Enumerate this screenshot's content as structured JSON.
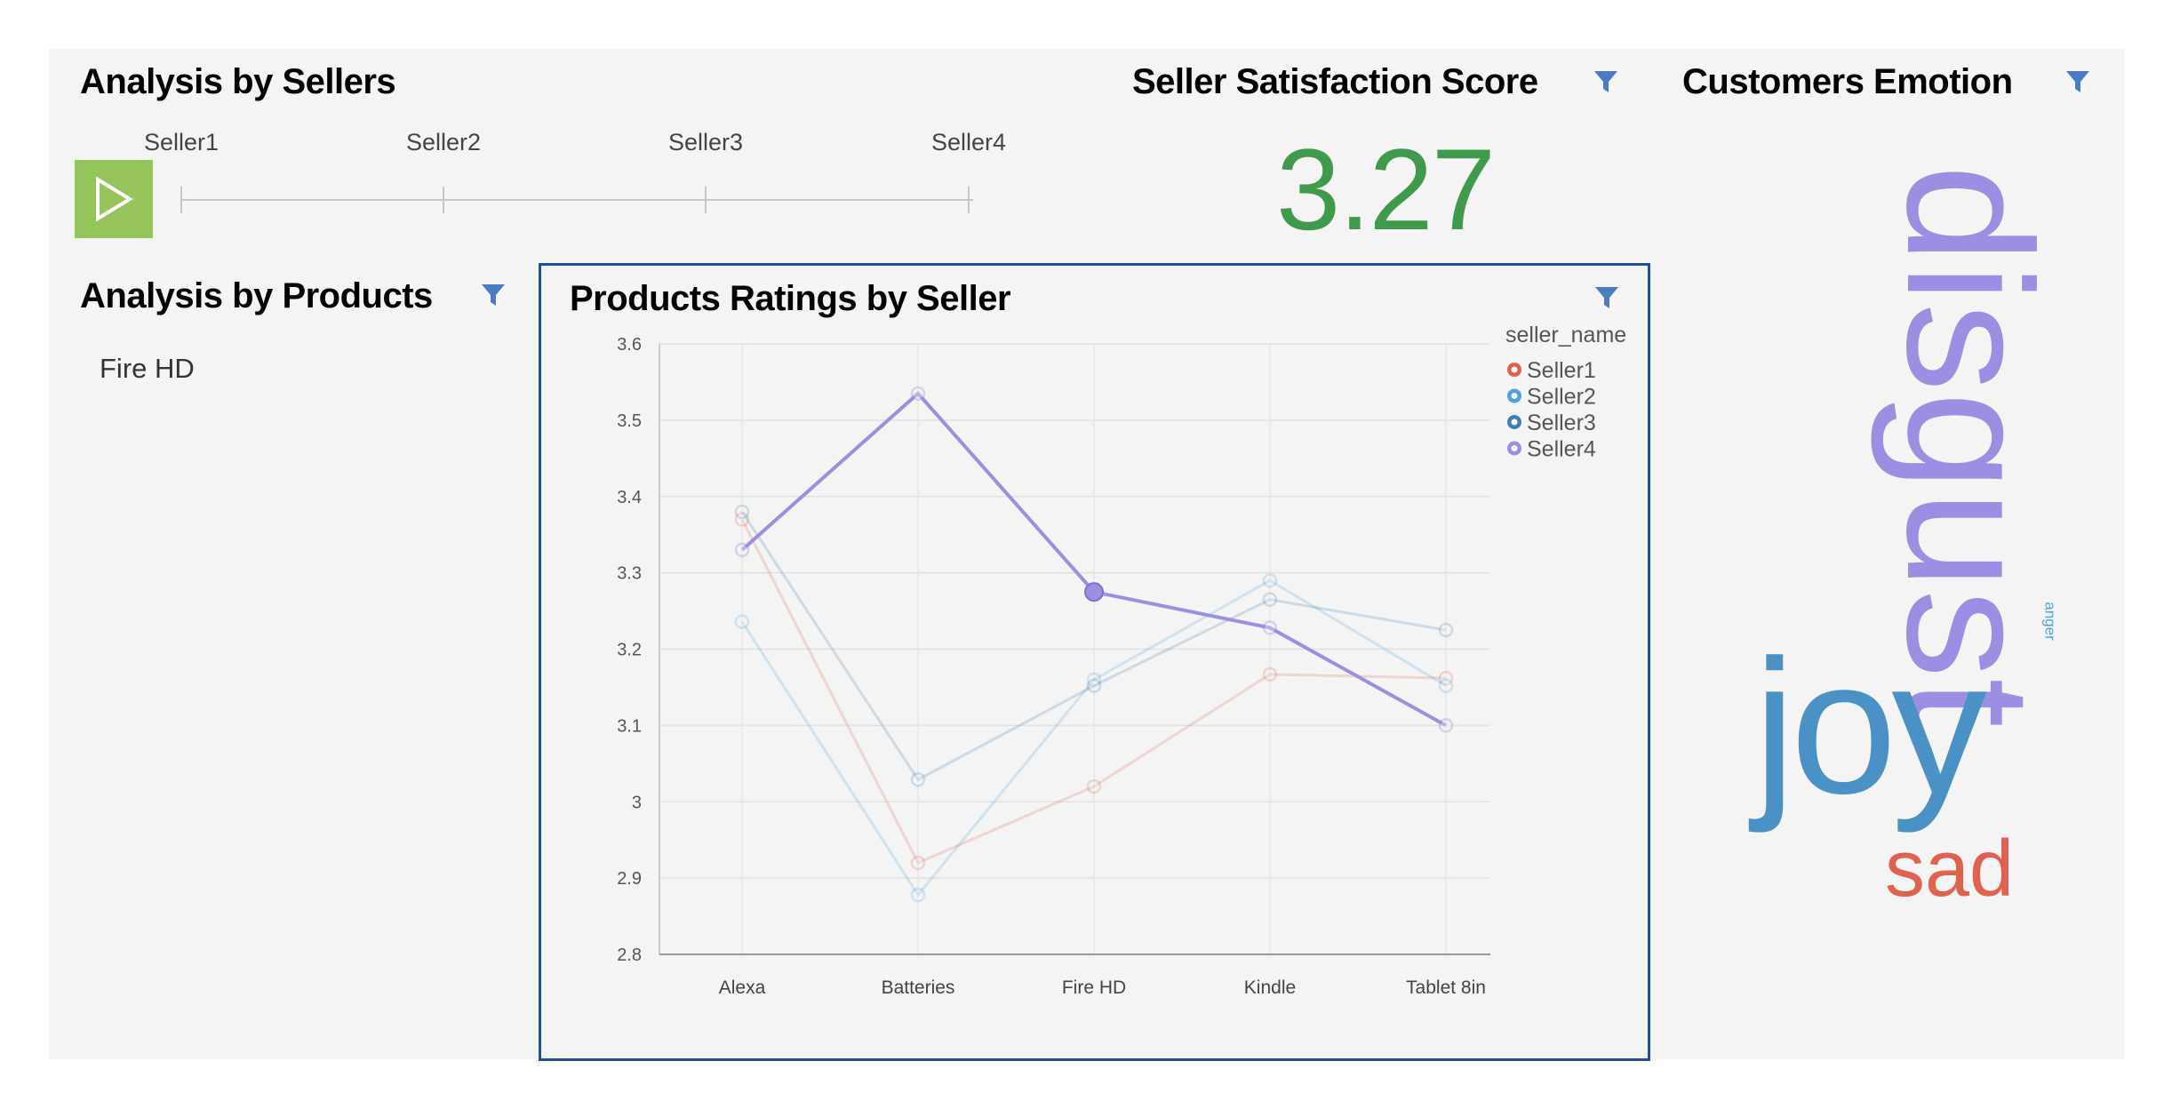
{
  "panels": {
    "sellers": {
      "title": "Analysis by Sellers",
      "sellers": [
        "Seller1",
        "Seller2",
        "Seller3",
        "Seller4"
      ]
    },
    "score": {
      "title": "Seller Satisfaction Score",
      "value": "3.27",
      "color": "#3f9a4c"
    },
    "emotion": {
      "title": "Customers Emotion",
      "words": [
        {
          "text": "disgust",
          "color": "#9c8fe3"
        },
        {
          "text": "joy",
          "color": "#4a92c5"
        },
        {
          "text": "sad",
          "color": "#e0624c"
        },
        {
          "text": "anger",
          "color": "#4aa3df"
        }
      ]
    },
    "products": {
      "title": "Analysis by Products",
      "items": [
        "Fire HD"
      ]
    },
    "ratings": {
      "title": "Products Ratings by Seller"
    }
  },
  "icons": {
    "play": "play-icon",
    "filter": "filter-icon"
  },
  "colors": {
    "accent": "#4a7bc4",
    "play_bg": "#94c45a",
    "chart_border": "#1f4e9a"
  },
  "chart_data": {
    "type": "line",
    "title": "Products Ratings by Seller",
    "categories": [
      "Alexa",
      "Batteries",
      "Fire HD",
      "Kindle",
      "Tablet 8in"
    ],
    "ylim": [
      2.8,
      3.6
    ],
    "yticks": [
      "2.8",
      "2.9",
      "3",
      "3.1",
      "3.2",
      "3.3",
      "3.4",
      "3.5",
      "3.6"
    ],
    "legend_title": "seller_name",
    "legend_position": "top-right",
    "grid": true,
    "highlighted_series": "Seller4",
    "highlighted_point": {
      "series": "Seller4",
      "category": "Fire HD"
    },
    "series": [
      {
        "name": "Seller1",
        "color": "#e0624c",
        "values": [
          3.37,
          2.92,
          3.02,
          3.167,
          3.162
        ]
      },
      {
        "name": "Seller2",
        "color": "#4aa3df",
        "values": [
          3.236,
          2.878,
          3.16,
          3.29,
          3.152
        ]
      },
      {
        "name": "Seller3",
        "color": "#3d7fb0",
        "values": [
          3.38,
          3.029,
          3.152,
          3.265,
          3.225
        ]
      },
      {
        "name": "Seller4",
        "color": "#9c8fe3",
        "values": [
          3.33,
          3.535,
          3.275,
          3.228,
          3.1
        ]
      }
    ]
  }
}
